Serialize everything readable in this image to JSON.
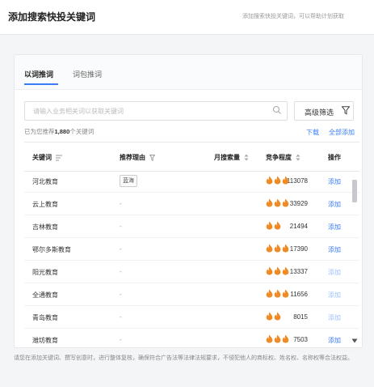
{
  "header": {
    "title": "添加搜索快投关键词",
    "subtitle": "添加搜索快投关键词，可以帮助计划获取"
  },
  "tabs": [
    {
      "label": "以词推词",
      "active": true
    },
    {
      "label": "词包推词",
      "active": false
    }
  ],
  "search": {
    "placeholder": "请输入业务相关词以获取关键词",
    "filter_label": "高级筛选"
  },
  "summary": {
    "prefix": "已为您推荐",
    "count": "1,880",
    "suffix": "个关键词",
    "download": "下载",
    "add_all": "全部添加"
  },
  "table": {
    "headers": {
      "keyword": "关键词",
      "reason": "推荐理由",
      "volume": "月搜索量",
      "competition": "竞争程度",
      "action": "操作"
    },
    "rows": [
      {
        "keyword": "河北教育",
        "reason": "蓝海",
        "reason_is_tag": true,
        "volume": "113078",
        "competition": 3,
        "action": "添加",
        "added": false
      },
      {
        "keyword": "云上教育",
        "reason": "-",
        "reason_is_tag": false,
        "volume": "33929",
        "competition": 3,
        "action": "添加",
        "added": false
      },
      {
        "keyword": "吉林教育",
        "reason": "-",
        "reason_is_tag": false,
        "volume": "21494",
        "competition": 2,
        "action": "添加",
        "added": false
      },
      {
        "keyword": "鄂尔多斯教育",
        "reason": "-",
        "reason_is_tag": false,
        "volume": "17390",
        "competition": 3,
        "action": "添加",
        "added": false
      },
      {
        "keyword": "阳光教育",
        "reason": "-",
        "reason_is_tag": false,
        "volume": "13337",
        "competition": 3,
        "action": "添加",
        "added": true
      },
      {
        "keyword": "全通教育",
        "reason": "-",
        "reason_is_tag": false,
        "volume": "11656",
        "competition": 3,
        "action": "添加",
        "added": true
      },
      {
        "keyword": "青岛教育",
        "reason": "-",
        "reason_is_tag": false,
        "volume": "8015",
        "competition": 2,
        "action": "添加",
        "added": true
      },
      {
        "keyword": "潍坊教育",
        "reason": "-",
        "reason_is_tag": false,
        "volume": "7503",
        "competition": 3,
        "action": "添加",
        "added": false
      }
    ]
  },
  "footer": {
    "note": "请您在添加关键词、撰写创意时，进行整体复核，确保符合广告法等法律法规要求，不侵犯他人的商标权、姓名权、名称权等合法权益。"
  },
  "colors": {
    "accent": "#3a7cf6",
    "flame": "#f08a24"
  }
}
